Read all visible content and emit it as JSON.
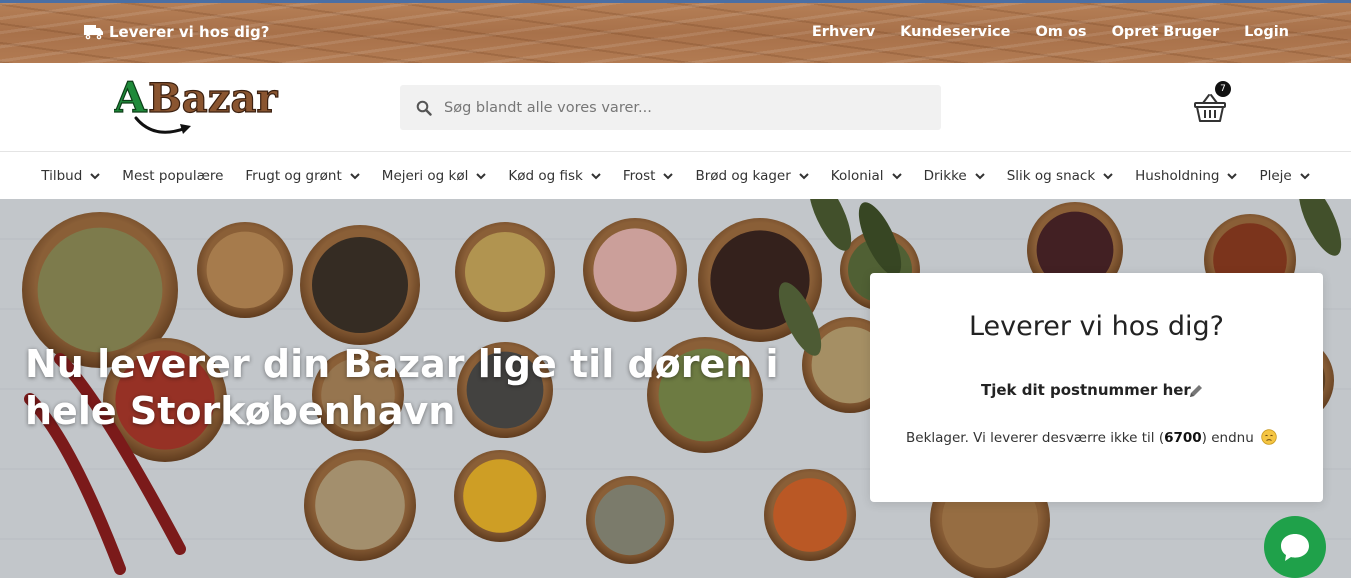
{
  "topbar": {
    "delivery_label": "Leverer vi hos dig?",
    "links": [
      "Erhverv",
      "Kundeservice",
      "Om os",
      "Opret Bruger",
      "Login"
    ]
  },
  "header": {
    "logo_text": "A Bazar",
    "search_placeholder": "Søg blandt alle vores varer...",
    "cart_count": "7"
  },
  "categories": [
    {
      "label": "Tilbud",
      "dropdown": true
    },
    {
      "label": "Mest populære",
      "dropdown": false
    },
    {
      "label": "Frugt og grønt",
      "dropdown": true
    },
    {
      "label": "Mejeri og køl",
      "dropdown": true
    },
    {
      "label": "Kød og fisk",
      "dropdown": true
    },
    {
      "label": "Frost",
      "dropdown": true
    },
    {
      "label": "Brød og kager",
      "dropdown": true
    },
    {
      "label": "Kolonial",
      "dropdown": true
    },
    {
      "label": "Drikke",
      "dropdown": true
    },
    {
      "label": "Slik og snack",
      "dropdown": true
    },
    {
      "label": "Husholdning",
      "dropdown": true
    },
    {
      "label": "Pleje",
      "dropdown": true
    }
  ],
  "hero": {
    "title": "Nu leverer din Bazar lige til døren i hele Storkøbenhavn"
  },
  "postal_card": {
    "title": "Leverer vi hos dig?",
    "check_label": "Tjek dit postnummer her",
    "message_prefix": "Beklager. Vi leverer desværre ikke til (",
    "postal_code": "6700",
    "message_suffix": ") endnu"
  },
  "colors": {
    "topbar_wood": "#a8714a",
    "logo_green": "#1f8a3a",
    "logo_brown": "#8a5530",
    "chat_green": "#1fa14a"
  }
}
